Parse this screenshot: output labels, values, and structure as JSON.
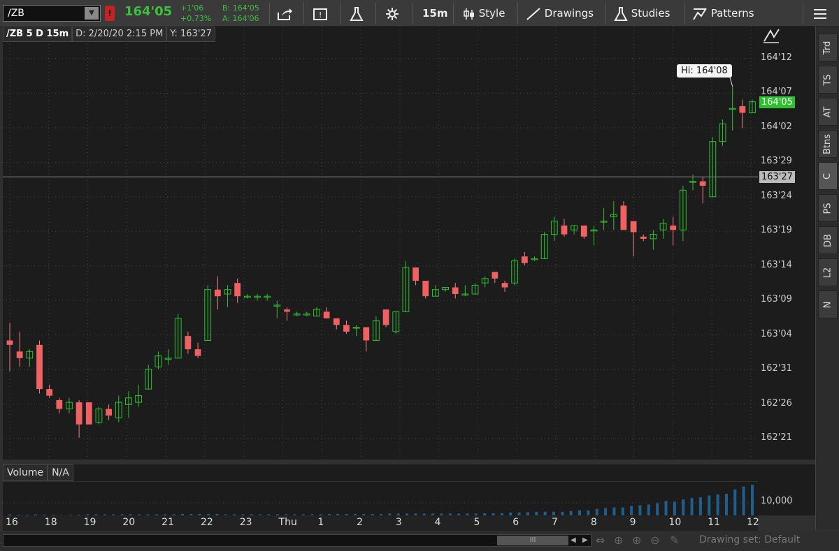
{
  "toolbar": {
    "symbol": "/ZB",
    "badge": "!",
    "last_price": "164'05",
    "change_abs": "+1'06",
    "change_pct": "+0.73%",
    "bid": "B: 164'05",
    "ask": "A: 164'06",
    "timeframe": "15m",
    "style_label": "Style",
    "drawings_label": "Drawings",
    "studies_label": "Studies",
    "patterns_label": "Patterns"
  },
  "infobar": {
    "symbol_desc": "/ZB 5 D 15m",
    "date": "D: 2/20/20 2:15 PM",
    "yvalue": "Y: 163'27"
  },
  "price_tags": {
    "current": "164'05",
    "crosshair": "163'27",
    "high_tip": "Hi: 164'08"
  },
  "volume": {
    "label": "Volume",
    "value": "N/A",
    "axis_label": "10,000"
  },
  "right_tabs": [
    "Trd",
    "TS",
    "AT",
    "Btns",
    "C",
    "PS",
    "DB",
    "L2",
    "N"
  ],
  "bottom": {
    "scroll_thumb": "III",
    "drawing_set": "Drawing set: Default"
  },
  "colors": {
    "up": "#2fc02f",
    "down": "#f06262",
    "background": "#1c1c1c"
  },
  "chart_data": {
    "type": "candlestick",
    "yaxis_labels": [
      "164'12",
      "164'07",
      "164'02",
      "163'29",
      "163'24",
      "163'19",
      "163'14",
      "163'09",
      "163'04",
      "162'31",
      "162'26",
      "162'21"
    ],
    "ylim": [
      162.6,
      164.44
    ],
    "xaxis_labels": [
      "16",
      "18",
      "19",
      "20",
      "21",
      "22",
      "23",
      "Thu",
      "1",
      "2",
      "3",
      "4",
      "5",
      "6",
      "7",
      "8",
      "9",
      "10",
      "11",
      "12"
    ],
    "candles": [
      {
        "o": 163.1,
        "h": 163.18,
        "l": 162.96,
        "c": 163.08
      },
      {
        "o": 163.05,
        "h": 163.14,
        "l": 162.98,
        "c": 163.02
      },
      {
        "o": 163.02,
        "h": 163.06,
        "l": 162.98,
        "c": 163.05
      },
      {
        "o": 163.08,
        "h": 163.1,
        "l": 162.86,
        "c": 162.88
      },
      {
        "o": 162.88,
        "h": 162.9,
        "l": 162.84,
        "c": 162.85
      },
      {
        "o": 162.83,
        "h": 162.84,
        "l": 162.77,
        "c": 162.79
      },
      {
        "o": 162.79,
        "h": 162.84,
        "l": 162.77,
        "c": 162.82
      },
      {
        "o": 162.82,
        "h": 162.83,
        "l": 162.66,
        "c": 162.72
      },
      {
        "o": 162.82,
        "h": 162.82,
        "l": 162.72,
        "c": 162.72
      },
      {
        "o": 162.73,
        "h": 162.8,
        "l": 162.72,
        "c": 162.79
      },
      {
        "o": 162.79,
        "h": 162.81,
        "l": 162.74,
        "c": 162.76
      },
      {
        "o": 162.75,
        "h": 162.85,
        "l": 162.73,
        "c": 162.82
      },
      {
        "o": 162.81,
        "h": 162.87,
        "l": 162.75,
        "c": 162.84
      },
      {
        "o": 162.82,
        "h": 162.9,
        "l": 162.8,
        "c": 162.85
      },
      {
        "o": 162.88,
        "h": 162.99,
        "l": 162.88,
        "c": 162.97
      },
      {
        "o": 162.98,
        "h": 163.05,
        "l": 162.97,
        "c": 163.03
      },
      {
        "o": 163.02,
        "h": 163.06,
        "l": 162.99,
        "c": 163.02
      },
      {
        "o": 163.02,
        "h": 163.22,
        "l": 163.02,
        "c": 163.2
      },
      {
        "o": 163.12,
        "h": 163.14,
        "l": 163.04,
        "c": 163.06
      },
      {
        "o": 163.06,
        "h": 163.09,
        "l": 163.02,
        "c": 163.03
      },
      {
        "o": 163.1,
        "h": 163.35,
        "l": 163.1,
        "c": 163.33
      },
      {
        "o": 163.33,
        "h": 163.39,
        "l": 163.24,
        "c": 163.3
      },
      {
        "o": 163.31,
        "h": 163.35,
        "l": 163.25,
        "c": 163.33
      },
      {
        "o": 163.36,
        "h": 163.38,
        "l": 163.27,
        "c": 163.3
      },
      {
        "o": 163.3,
        "h": 163.31,
        "l": 163.29,
        "c": 163.3
      },
      {
        "o": 163.3,
        "h": 163.31,
        "l": 163.28,
        "c": 163.3
      },
      {
        "o": 163.3,
        "h": 163.31,
        "l": 163.28,
        "c": 163.3
      },
      {
        "o": 163.26,
        "h": 163.28,
        "l": 163.2,
        "c": 163.26
      },
      {
        "o": 163.24,
        "h": 163.25,
        "l": 163.19,
        "c": 163.23
      },
      {
        "o": 163.22,
        "h": 163.23,
        "l": 163.21,
        "c": 163.22
      },
      {
        "o": 163.22,
        "h": 163.23,
        "l": 163.21,
        "c": 163.22
      },
      {
        "o": 163.21,
        "h": 163.25,
        "l": 163.21,
        "c": 163.24
      },
      {
        "o": 163.23,
        "h": 163.25,
        "l": 163.2,
        "c": 163.2
      },
      {
        "o": 163.2,
        "h": 163.2,
        "l": 163.15,
        "c": 163.17
      },
      {
        "o": 163.17,
        "h": 163.19,
        "l": 163.13,
        "c": 163.14
      },
      {
        "o": 163.16,
        "h": 163.17,
        "l": 163.12,
        "c": 163.16
      },
      {
        "o": 163.16,
        "h": 163.16,
        "l": 163.05,
        "c": 163.1
      },
      {
        "o": 163.1,
        "h": 163.21,
        "l": 163.1,
        "c": 163.19
      },
      {
        "o": 163.24,
        "h": 163.24,
        "l": 163.16,
        "c": 163.17
      },
      {
        "o": 163.14,
        "h": 163.23,
        "l": 163.13,
        "c": 163.23
      },
      {
        "o": 163.23,
        "h": 163.46,
        "l": 163.23,
        "c": 163.43
      },
      {
        "o": 163.43,
        "h": 163.43,
        "l": 163.35,
        "c": 163.37
      },
      {
        "o": 163.37,
        "h": 163.37,
        "l": 163.29,
        "c": 163.3
      },
      {
        "o": 163.3,
        "h": 163.35,
        "l": 163.3,
        "c": 163.33
      },
      {
        "o": 163.33,
        "h": 163.34,
        "l": 163.32,
        "c": 163.34
      },
      {
        "o": 163.34,
        "h": 163.36,
        "l": 163.29,
        "c": 163.31
      },
      {
        "o": 163.31,
        "h": 163.35,
        "l": 163.3,
        "c": 163.31
      },
      {
        "o": 163.31,
        "h": 163.36,
        "l": 163.31,
        "c": 163.35
      },
      {
        "o": 163.36,
        "h": 163.39,
        "l": 163.34,
        "c": 163.38
      },
      {
        "o": 163.41,
        "h": 163.41,
        "l": 163.36,
        "c": 163.38
      },
      {
        "o": 163.36,
        "h": 163.37,
        "l": 163.32,
        "c": 163.34
      },
      {
        "o": 163.36,
        "h": 163.47,
        "l": 163.35,
        "c": 163.46
      },
      {
        "o": 163.48,
        "h": 163.5,
        "l": 163.44,
        "c": 163.45
      },
      {
        "o": 163.47,
        "h": 163.48,
        "l": 163.46,
        "c": 163.47
      },
      {
        "o": 163.47,
        "h": 163.59,
        "l": 163.47,
        "c": 163.58
      },
      {
        "o": 163.58,
        "h": 163.66,
        "l": 163.55,
        "c": 163.64
      },
      {
        "o": 163.62,
        "h": 163.65,
        "l": 163.57,
        "c": 163.58
      },
      {
        "o": 163.6,
        "h": 163.62,
        "l": 163.58,
        "c": 163.62
      },
      {
        "o": 163.62,
        "h": 163.62,
        "l": 163.56,
        "c": 163.57
      },
      {
        "o": 163.6,
        "h": 163.62,
        "l": 163.53,
        "c": 163.6
      },
      {
        "o": 163.64,
        "h": 163.7,
        "l": 163.6,
        "c": 163.64
      },
      {
        "o": 163.66,
        "h": 163.73,
        "l": 163.6,
        "c": 163.67
      },
      {
        "o": 163.71,
        "h": 163.73,
        "l": 163.62,
        "c": 163.6
      },
      {
        "o": 163.64,
        "h": 163.64,
        "l": 163.48,
        "c": 163.59
      },
      {
        "o": 163.57,
        "h": 163.58,
        "l": 163.55,
        "c": 163.56
      },
      {
        "o": 163.56,
        "h": 163.6,
        "l": 163.51,
        "c": 163.58
      },
      {
        "o": 163.6,
        "h": 163.65,
        "l": 163.56,
        "c": 163.63
      },
      {
        "o": 163.62,
        "h": 163.66,
        "l": 163.53,
        "c": 163.6
      },
      {
        "o": 163.6,
        "h": 163.8,
        "l": 163.55,
        "c": 163.78
      },
      {
        "o": 163.82,
        "h": 163.85,
        "l": 163.78,
        "c": 163.82
      },
      {
        "o": 163.82,
        "h": 163.84,
        "l": 163.72,
        "c": 163.8
      },
      {
        "o": 163.75,
        "h": 164.02,
        "l": 163.75,
        "c": 164.0
      },
      {
        "o": 164.0,
        "h": 164.1,
        "l": 163.98,
        "c": 164.08
      },
      {
        "o": 164.15,
        "h": 164.25,
        "l": 164.05,
        "c": 164.15
      },
      {
        "o": 164.16,
        "h": 164.19,
        "l": 164.06,
        "c": 164.13
      },
      {
        "o": 164.13,
        "h": 164.19,
        "l": 164.13,
        "c": 164.18
      }
    ],
    "volume": [
      3,
      2,
      2,
      3,
      2,
      2,
      1,
      2,
      2,
      3,
      3,
      3,
      3,
      3,
      3,
      3,
      3,
      3,
      3,
      3,
      4,
      4,
      4,
      4,
      4,
      3,
      3,
      3,
      3,
      3,
      3,
      3,
      3,
      3,
      3,
      3,
      3,
      4,
      4,
      4,
      4,
      4,
      4,
      4,
      5,
      5,
      5,
      5,
      5,
      5,
      5,
      5,
      5,
      5,
      5,
      6,
      6,
      6,
      8,
      8,
      9,
      10,
      10,
      10,
      10,
      12,
      14,
      14,
      18,
      20,
      22,
      22,
      26,
      28,
      30,
      34,
      40,
      38,
      44,
      48,
      50,
      55,
      58,
      60,
      72,
      80,
      85
    ]
  }
}
